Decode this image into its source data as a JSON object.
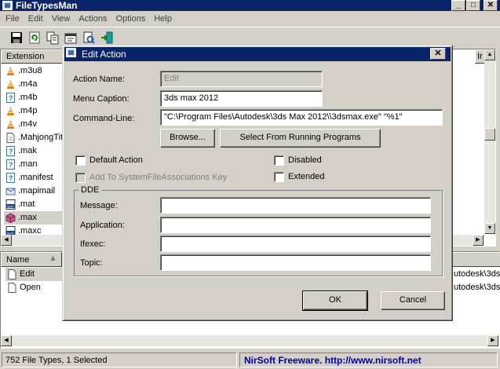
{
  "window": {
    "title": "FileTypesMan",
    "min_glyph": "_",
    "max_glyph": "□",
    "close_glyph": "✕"
  },
  "menu": [
    "File",
    "Edit",
    "View",
    "Actions",
    "Options",
    "Help"
  ],
  "toolbar": {
    "icons": [
      "save-icon",
      "refresh-icon",
      "copy-icon",
      "properties-icon",
      "find-icon",
      "exit-icon"
    ]
  },
  "list": {
    "column_extension": "Extension",
    "column_partial": "Ir",
    "rows": [
      {
        "ext": ".m3u8",
        "icon": "vlc-icon"
      },
      {
        "ext": ".m4a",
        "icon": "vlc-icon"
      },
      {
        "ext": ".m4b",
        "icon": "unknown-file-icon"
      },
      {
        "ext": ".m4p",
        "icon": "vlc-icon"
      },
      {
        "ext": ".m4v",
        "icon": "vlc-icon"
      },
      {
        "ext": ".MahjongTitans",
        "icon": "document-icon"
      },
      {
        "ext": ".mak",
        "icon": "unknown-file-icon"
      },
      {
        "ext": ".man",
        "icon": "unknown-file-icon"
      },
      {
        "ext": ".manifest",
        "icon": "unknown-file-icon"
      },
      {
        "ext": ".mapimail",
        "icon": "mail-icon"
      },
      {
        "ext": ".mat",
        "icon": "mat-icon"
      },
      {
        "ext": ".max",
        "icon": "3dsmax-icon",
        "selected": true
      },
      {
        "ext": ".maxc",
        "icon": "maxc-icon"
      }
    ]
  },
  "actions_list": {
    "column_name": "Name",
    "rows": [
      {
        "name": "Edit",
        "right_text": "utodesk\\3ds",
        "selected": true
      },
      {
        "name": "Open",
        "right_text": "utodesk\\3ds"
      }
    ]
  },
  "status": {
    "left": "752 File Types, 1 Selected",
    "right": "NirSoft Freeware.  http://www.nirsoft.net"
  },
  "dialog": {
    "title": "Edit Action",
    "action_name_label": "Action Name:",
    "action_name_value": "Edit",
    "menu_caption_label": "Menu Caption:",
    "menu_caption_value": "3ds max 2012",
    "command_line_label": "Command-Line:",
    "command_line_value": "\"C:\\Program Files\\Autodesk\\3ds Max 2012\\\\3dsmax.exe\" \"%1\"",
    "browse_button": "Browse...",
    "select_running_button": "Select From Running Programs",
    "default_action_label": "Default Action",
    "default_action_checked": false,
    "add_sysassoc_label": "Add To SystemFileAssociations Key",
    "add_sysassoc_checked": false,
    "disabled_label": "Disabled",
    "disabled_checked": false,
    "extended_label": "Extended",
    "extended_checked": false,
    "dde_group": "DDE",
    "message_label": "Message:",
    "application_label": "Application:",
    "ifexec_label": "Ifexec:",
    "topic_label": "Topic:",
    "message_value": "",
    "application_value": "",
    "ifexec_value": "",
    "topic_value": "",
    "ok_button": "OK",
    "cancel_button": "Cancel"
  },
  "colors": {
    "titlebar": "#0a246a",
    "face": "#d4d0c8",
    "link": "#0000a0"
  }
}
